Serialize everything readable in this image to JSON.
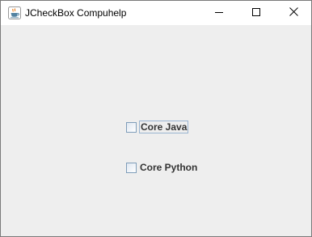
{
  "window": {
    "title": "JCheckBox Compuhelp",
    "app_icon": "java-coffee-cup-icon",
    "controls": [
      "minimize-icon",
      "maximize-icon",
      "close-icon"
    ]
  },
  "checkboxes": [
    {
      "label": "Core Java",
      "checked": false,
      "focused": true
    },
    {
      "label": "Core Python",
      "checked": false,
      "focused": false
    }
  ],
  "colors": {
    "background": "#eeeeee",
    "titlebar": "#ffffff",
    "checkbox_border": "#7f9db9",
    "focus_border": "#99b4d1",
    "label_text": "#333333"
  }
}
